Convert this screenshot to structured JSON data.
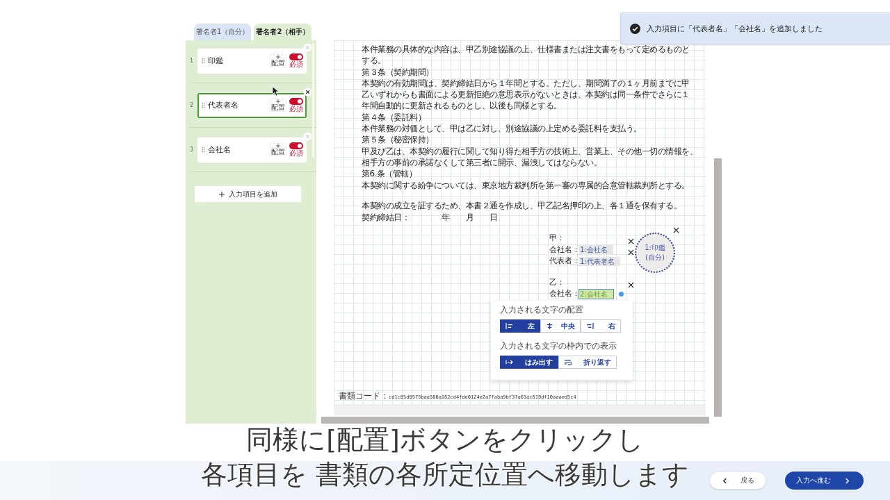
{
  "toast": {
    "message": "入力項目に「代表者名」「会社名」を追加しました"
  },
  "signer_tabs": [
    {
      "label": "署名者1（自分）",
      "selected": false
    },
    {
      "label": "署名者2（相手）",
      "selected": true
    }
  ],
  "fields": [
    {
      "number": "1",
      "name": "印鑑",
      "place_button": "配置",
      "required": true,
      "required_label": "必須",
      "selected": false
    },
    {
      "number": "2",
      "name": "代表者名",
      "place_button": "配置",
      "required": true,
      "required_label": "必須",
      "selected": true
    },
    {
      "number": "3",
      "name": "会社名",
      "place_button": "配置",
      "required": true,
      "required_label": "必須",
      "selected": false
    }
  ],
  "add_field_button": "入力項目を追加",
  "document": {
    "clause_lines": [
      "本件業務の具体的な内容は、甲乙別途協議の上、仕様書または注文書をもって定めるものと",
      "する。",
      "第３条（契約期間）",
      "本契約の有効期間は、契約締結日から１年間とする。ただし、期間満了の１ヶ月前までに甲",
      "乙いずれからも書面による更新拒絶の意思表示がないときは、本契約は同一条件でさらに１",
      "年間自動的に更新されるものとし、以後も同様とする。",
      "第４条（委託料）",
      "本件業務の対価として、甲は乙に対し、別途協議の上定める委託料を支払う。",
      "第５条（秘密保持）",
      "甲及び乙は、本契約の履行に関して知り得た相手方の技術上、営業上、その他一切の情報を、",
      "相手方の事前の承諾なくして第三者に開示、漏洩してはならない。",
      "第6.条（管轄）",
      "本契約に関する紛争については、東京地方裁判所を第一審の専属的合意管轄裁判所とする。"
    ],
    "closing_lines": [
      "本契約の成立を証するため、本書２通を作成し、甲乙記名押印の上、各１通を保有する。",
      "契約締結日：　　　　年　　月　　日"
    ],
    "signature_rows": [
      {
        "kind": "party",
        "label": "甲："
      },
      {
        "kind": "field",
        "label": "会社名：",
        "field": {
          "text": "1:会社名",
          "selected": false
        }
      },
      {
        "kind": "field",
        "label": "代表者：",
        "field": {
          "text": "1:代表者名",
          "selected": false
        }
      },
      {
        "kind": "party",
        "label": "乙："
      },
      {
        "kind": "field",
        "label": "会社名：",
        "field": {
          "text": "2:会社名",
          "selected": true
        }
      }
    ],
    "seal": {
      "lines": [
        "1:印鑑",
        "(自分)"
      ]
    },
    "document_code_label": "書類コード：",
    "document_code": "cd1c85d8575baa586a162cd4fde0124e2a7faba9bf37a63ac619df10aaaed5c4"
  },
  "text_options": {
    "alignment_title": "入力される文字の配置",
    "alignment": [
      {
        "kind": "left",
        "label": "左",
        "selected": true
      },
      {
        "kind": "center",
        "label": "中央",
        "selected": false
      },
      {
        "kind": "right",
        "label": "右",
        "selected": false
      }
    ],
    "display_title": "入力される文字の枠内での表示",
    "display": [
      {
        "kind": "overflow",
        "label": "はみ出す",
        "selected": true
      },
      {
        "kind": "wrap",
        "label": "折り返す",
        "selected": false
      }
    ]
  },
  "subtitle": [
    "同様に[配置]ボタンをクリックし",
    "各項目を 書類の各所定位置へ移動します"
  ],
  "back_button": "戻る",
  "next_button": "入力へ進む"
}
